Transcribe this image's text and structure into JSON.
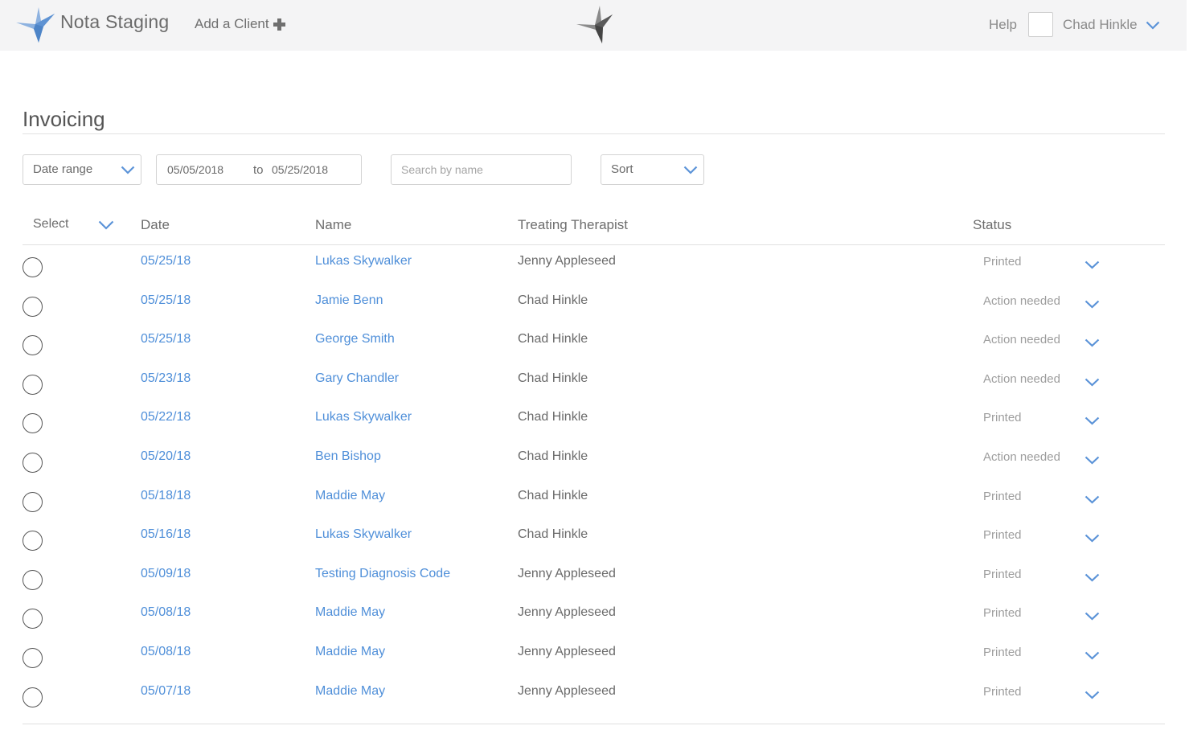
{
  "header": {
    "brand": "Nota Staging",
    "add_client": "Add a Client",
    "help": "Help",
    "user": "Chad Hinkle"
  },
  "page": {
    "title": "Invoicing"
  },
  "filters": {
    "date_range_label": "Date range",
    "from": "05/05/2018",
    "to_word": "to",
    "until": "05/25/2018",
    "search_placeholder": "Search by name",
    "sort_label": "Sort"
  },
  "table": {
    "columns": [
      "Select",
      "Date",
      "Name",
      "Treating Therapist",
      "Status"
    ],
    "rows": [
      {
        "date": "05/25/18",
        "name": "Lukas Skywalker",
        "therapist": "Jenny Appleseed",
        "status": "Printed"
      },
      {
        "date": "05/25/18",
        "name": "Jamie Benn",
        "therapist": "Chad Hinkle",
        "status": "Action needed"
      },
      {
        "date": "05/25/18",
        "name": "George Smith",
        "therapist": "Chad Hinkle",
        "status": "Action needed"
      },
      {
        "date": "05/23/18",
        "name": "Gary Chandler",
        "therapist": "Chad Hinkle",
        "status": "Action needed"
      },
      {
        "date": "05/22/18",
        "name": "Lukas Skywalker",
        "therapist": "Chad Hinkle",
        "status": "Printed"
      },
      {
        "date": "05/20/18",
        "name": "Ben Bishop",
        "therapist": "Chad Hinkle",
        "status": "Action needed"
      },
      {
        "date": "05/18/18",
        "name": "Maddie May",
        "therapist": "Chad Hinkle",
        "status": "Printed"
      },
      {
        "date": "05/16/18",
        "name": "Lukas Skywalker",
        "therapist": "Chad Hinkle",
        "status": "Printed"
      },
      {
        "date": "05/09/18",
        "name": "Testing Diagnosis Code",
        "therapist": "Jenny Appleseed",
        "status": "Printed"
      },
      {
        "date": "05/08/18",
        "name": "Maddie May",
        "therapist": "Jenny Appleseed",
        "status": "Printed"
      },
      {
        "date": "05/08/18",
        "name": "Maddie May",
        "therapist": "Jenny Appleseed",
        "status": "Printed"
      },
      {
        "date": "05/07/18",
        "name": "Maddie May",
        "therapist": "Jenny Appleseed",
        "status": "Printed"
      }
    ]
  },
  "icons": {
    "logo": "star-bird-logo-icon",
    "center_logo": "star-bird-logo-icon",
    "add": "plus-icon",
    "dropdown": "chevron-down-icon",
    "select_row": "radio-icon"
  },
  "colors": {
    "link": "#4f8fd9",
    "chevron": "#5b93d8",
    "topbar_bg": "#f4f4f5",
    "logo_blue": "#6f9fd8",
    "logo_gray": "#6d6d6d"
  }
}
